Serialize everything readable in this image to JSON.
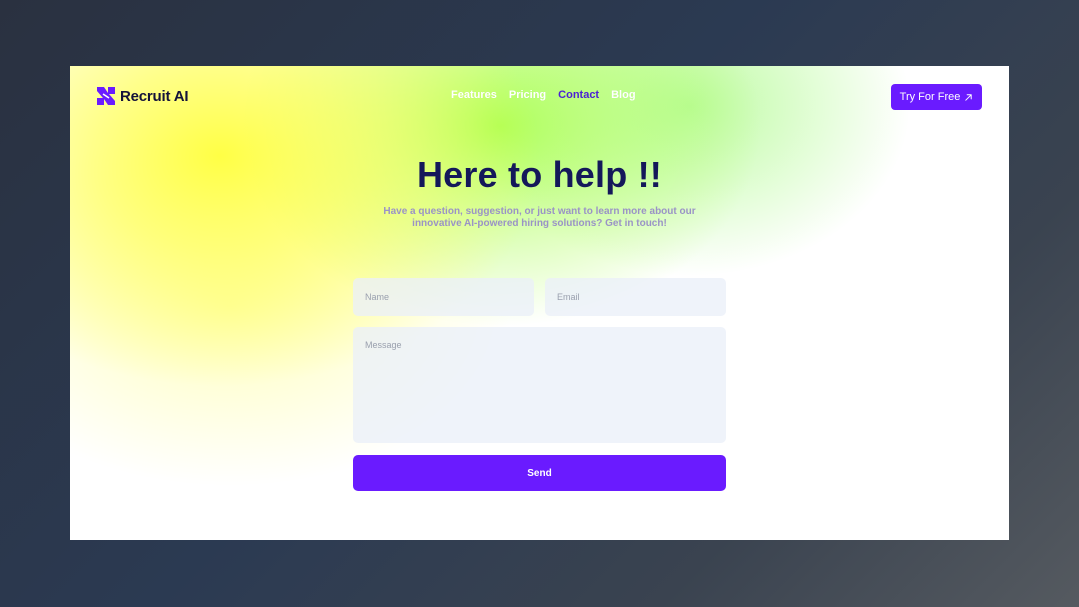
{
  "brand": {
    "name": "Recruit AI",
    "logo_icon": "recruit-ai-logo-icon",
    "color": "#6a1bff"
  },
  "nav": {
    "items": [
      {
        "label": "Features",
        "active": false
      },
      {
        "label": "Pricing",
        "active": false
      },
      {
        "label": "Contact",
        "active": true
      },
      {
        "label": "Blog",
        "active": false
      }
    ],
    "active_color": "#4b1fd6"
  },
  "cta": {
    "label": "Try For Free",
    "icon": "arrow-up-right-icon"
  },
  "hero": {
    "title": "Here to help !!",
    "subtitle_line1": "Have a question, suggestion, or just want to learn more about our",
    "subtitle_line2": "innovative AI-powered hiring solutions? Get in touch!"
  },
  "form": {
    "name_placeholder": "Name",
    "name_value": "",
    "email_placeholder": "Email",
    "email_value": "",
    "message_placeholder": "Message",
    "message_value": "",
    "submit_label": "Send"
  }
}
